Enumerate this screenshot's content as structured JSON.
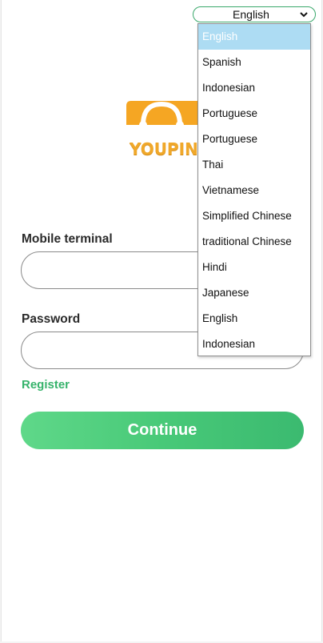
{
  "language_select": {
    "selected": "English",
    "options": [
      "English",
      "Spanish",
      "Indonesian",
      "Portuguese",
      "Portuguese",
      "Thai",
      "Vietnamese",
      "Simplified Chinese",
      "traditional Chinese",
      "Hindi",
      "Japanese",
      "English",
      "Indonesian"
    ]
  },
  "logo": {
    "text": "YOUPIN",
    "icon": "shopping-bag-icon",
    "color": "#f0a82a"
  },
  "form": {
    "mobile_label": "Mobile terminal",
    "mobile_value": "",
    "password_label": "Password",
    "password_value": "",
    "register_label": "Register",
    "continue_label": "Continue"
  },
  "colors": {
    "accent": "#48c978",
    "register": "#36b36b",
    "selected_option": "#addcf3",
    "logo": "#f0a82a"
  }
}
